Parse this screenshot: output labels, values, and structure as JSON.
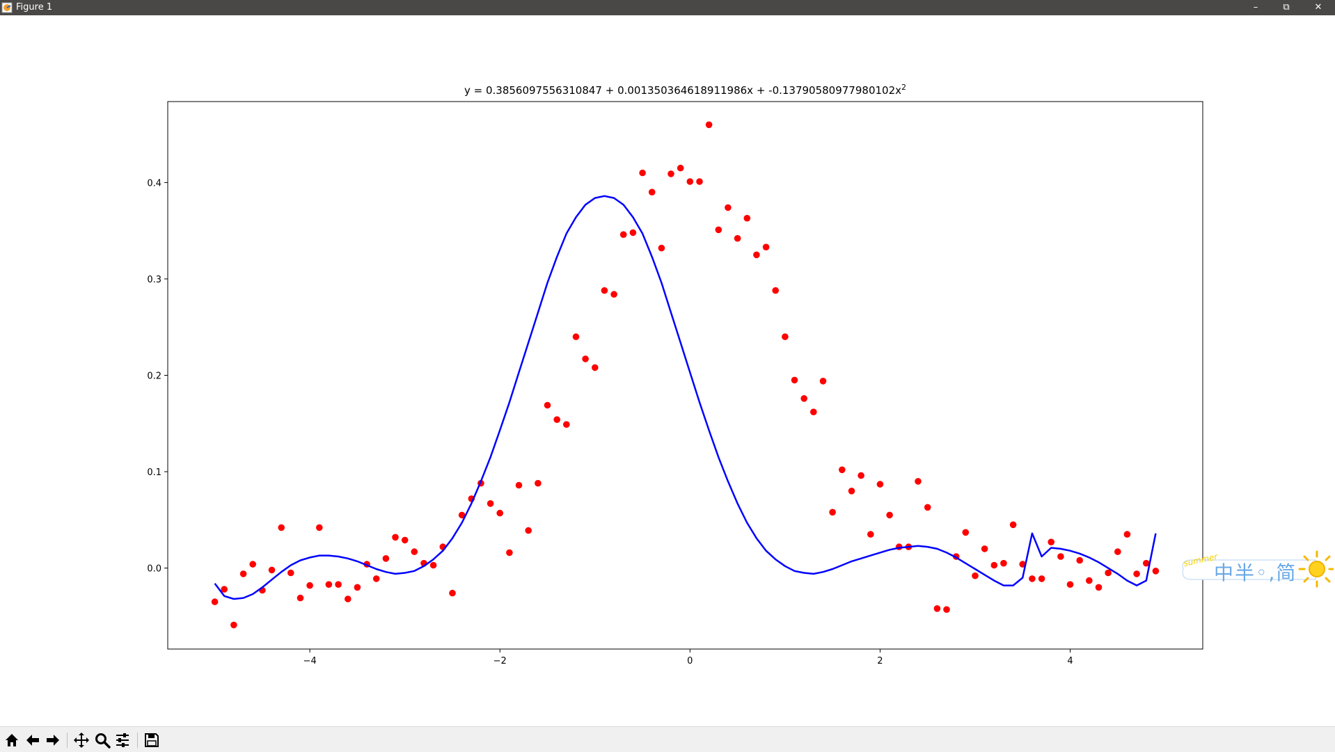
{
  "window": {
    "title": "Figure 1",
    "controls": {
      "minimize": "–",
      "restore": "⧉",
      "close": "✕"
    }
  },
  "toolbar": {
    "buttons": [
      "home-icon",
      "back-icon",
      "forward-icon",
      "pan-icon",
      "zoom-icon",
      "configure-subplots-icon",
      "save-icon"
    ]
  },
  "ime": {
    "badge": "summer",
    "text": "中半◦,简"
  },
  "chart_data": {
    "type": "scatter",
    "title": "y = 0.3856097556310847 + 0.001350364618911986x + -0.13790580977980102x",
    "title_superscript": "2",
    "xlabel": "",
    "ylabel": "",
    "xlim": [
      -5.495,
      5.395
    ],
    "ylim": [
      -0.084,
      0.484
    ],
    "xticks": [
      -4,
      -2,
      0,
      2,
      4
    ],
    "xtick_labels": [
      "−4",
      "−2",
      "0",
      "2",
      "4"
    ],
    "yticks": [
      0.0,
      0.1,
      0.2,
      0.3,
      0.4
    ],
    "ytick_labels": [
      "0.0",
      "0.1",
      "0.2",
      "0.3",
      "0.4"
    ],
    "grid": false,
    "colors": {
      "points": "#ff0000",
      "curve": "#0000ff",
      "frame": "#000000"
    },
    "series": [
      {
        "kind": "points",
        "x": [
          -5.0,
          -4.9,
          -4.8,
          -4.7,
          -4.6,
          -4.5,
          -4.4,
          -4.3,
          -4.2,
          -4.1,
          -4.0,
          -3.9,
          -3.8,
          -3.7,
          -3.6,
          -3.5,
          -3.4,
          -3.3,
          -3.2,
          -3.1,
          -3.0,
          -2.9,
          -2.8,
          -2.7,
          -2.6,
          -2.5,
          -2.4,
          -2.3,
          -2.2,
          -2.1,
          -2.0,
          -1.9,
          -1.8,
          -1.7,
          -1.6,
          -1.5,
          -1.4,
          -1.3,
          -1.2,
          -1.1,
          -1.0,
          -0.9,
          -0.8,
          -0.7,
          -0.6,
          -0.5,
          -0.4,
          -0.3,
          -0.2,
          -0.1,
          0.0,
          0.1,
          0.2,
          0.3,
          0.4,
          0.5,
          0.6,
          0.7,
          0.8,
          0.9,
          1.0,
          1.1,
          1.2,
          1.3,
          1.4,
          1.5,
          1.6,
          1.7,
          1.8,
          1.9,
          2.0,
          2.1,
          2.2,
          2.3,
          2.4,
          2.5,
          2.6,
          2.7,
          2.8,
          2.9,
          3.0,
          3.1,
          3.2,
          3.3,
          3.4,
          3.5,
          3.6,
          3.7,
          3.8,
          3.9,
          4.0,
          4.1,
          4.2,
          4.3,
          4.4,
          4.5,
          4.6,
          4.7,
          4.8,
          4.9
        ],
        "y": [
          -0.035,
          -0.022,
          -0.059,
          -0.006,
          0.004,
          -0.023,
          -0.002,
          0.042,
          -0.005,
          -0.031,
          -0.018,
          0.042,
          -0.017,
          -0.017,
          -0.032,
          -0.02,
          0.004,
          -0.011,
          0.01,
          0.032,
          0.029,
          0.017,
          0.005,
          0.003,
          0.022,
          -0.026,
          0.055,
          0.072,
          0.088,
          0.067,
          0.057,
          0.016,
          0.086,
          0.039,
          0.088,
          0.169,
          0.154,
          0.149,
          0.24,
          0.217,
          0.208,
          0.288,
          0.284,
          0.346,
          0.348,
          0.41,
          0.39,
          0.332,
          0.409,
          0.415,
          0.401,
          0.401,
          0.46,
          0.351,
          0.374,
          0.342,
          0.363,
          0.325,
          0.333,
          0.288,
          0.24,
          0.195,
          0.176,
          0.162,
          0.194,
          0.058,
          0.102,
          0.08,
          0.096,
          0.035,
          0.087,
          0.055,
          0.022,
          0.022,
          0.09,
          0.063,
          -0.042,
          -0.043,
          0.012,
          0.037,
          -0.008,
          0.02,
          0.003,
          0.005,
          0.045,
          0.004,
          -0.011,
          -0.011,
          0.027,
          0.012,
          -0.017,
          0.008,
          -0.013,
          -0.02,
          -0.005,
          0.017,
          0.035,
          -0.006,
          0.005,
          -0.003
        ]
      },
      {
        "kind": "curve",
        "x": [
          -5.0,
          -4.9,
          -4.8,
          -4.7,
          -4.6,
          -4.5,
          -4.4,
          -4.3,
          -4.2,
          -4.1,
          -4.0,
          -3.9,
          -3.8,
          -3.7,
          -3.6,
          -3.5,
          -3.4,
          -3.3,
          -3.2,
          -3.1,
          -3.0,
          -2.9,
          -2.8,
          -2.7,
          -2.6,
          -2.5,
          -2.4,
          -2.3,
          -2.2,
          -2.1,
          -2.0,
          -1.9,
          -1.8,
          -1.7,
          -1.6,
          -1.5,
          -1.4,
          -1.3,
          -1.2,
          -1.1,
          -1.0,
          -0.9,
          -0.8,
          -0.7,
          -0.6,
          -0.5,
          -0.4,
          -0.3,
          -0.2,
          -0.1,
          0.0,
          0.1,
          0.2,
          0.3,
          0.4,
          0.5,
          0.6,
          0.7,
          0.8,
          0.9,
          1.0,
          1.1,
          1.2,
          1.3,
          1.4,
          1.5,
          1.6,
          1.7,
          1.8,
          1.9,
          2.0,
          2.1,
          2.2,
          2.3,
          2.4,
          2.5,
          2.6,
          2.7,
          2.8,
          2.9,
          3.0,
          3.1,
          3.2,
          3.3,
          3.4,
          3.5,
          3.6,
          3.7,
          3.8,
          3.9,
          4.0,
          4.1,
          4.2,
          4.3,
          4.4,
          4.5,
          4.6,
          4.7,
          4.8,
          4.9
        ],
        "y": [
          -0.016,
          -0.029,
          -0.032,
          -0.031,
          -0.027,
          -0.02,
          -0.012,
          -0.004,
          0.003,
          0.008,
          0.011,
          0.013,
          0.013,
          0.012,
          0.01,
          0.007,
          0.003,
          -0.001,
          -0.004,
          -0.006,
          -0.005,
          -0.003,
          0.002,
          0.009,
          0.018,
          0.031,
          0.047,
          0.067,
          0.09,
          0.115,
          0.143,
          0.172,
          0.203,
          0.234,
          0.265,
          0.296,
          0.323,
          0.347,
          0.364,
          0.377,
          0.384,
          0.386,
          0.384,
          0.377,
          0.364,
          0.347,
          0.323,
          0.296,
          0.265,
          0.234,
          0.203,
          0.172,
          0.143,
          0.115,
          0.09,
          0.067,
          0.047,
          0.031,
          0.018,
          0.009,
          0.002,
          -0.003,
          -0.005,
          -0.006,
          -0.004,
          -0.001,
          0.003,
          0.007,
          0.01,
          0.013,
          0.016,
          0.019,
          0.021,
          0.022,
          0.023,
          0.022,
          0.02,
          0.016,
          0.011,
          0.005,
          -0.001,
          -0.007,
          -0.013,
          -0.018,
          -0.018,
          -0.01,
          0.036,
          0.012,
          0.021,
          0.02,
          0.018,
          0.015,
          0.011,
          0.006,
          0.0,
          -0.006,
          -0.013,
          -0.018,
          -0.013,
          0.036
        ]
      }
    ]
  }
}
